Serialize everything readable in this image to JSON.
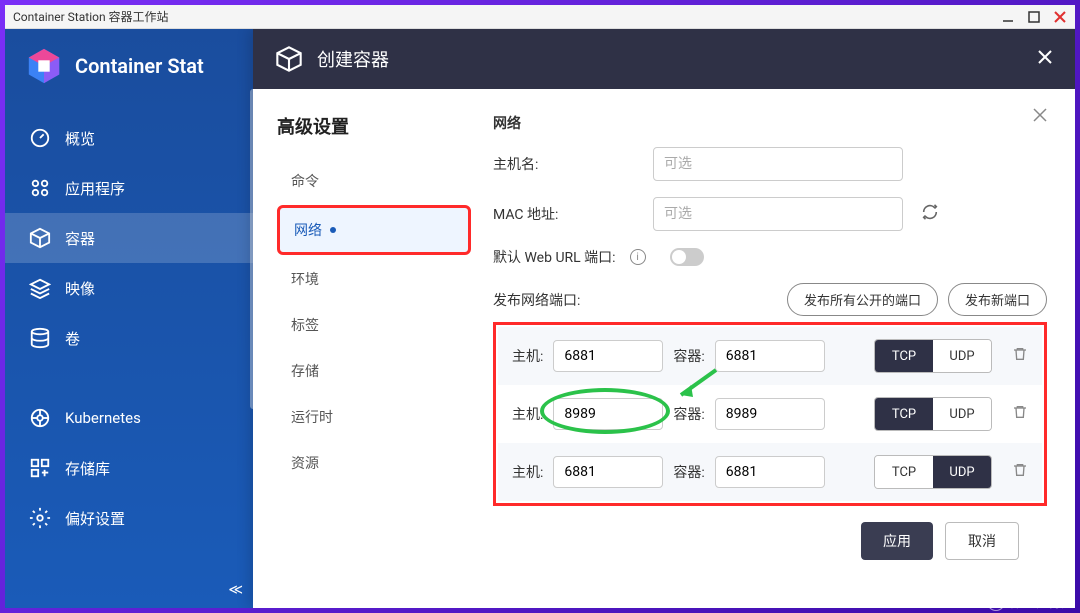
{
  "titlebar": {
    "title": "Container Station 容器工作站"
  },
  "sidebar": {
    "app_name": "Container Stat",
    "items": [
      {
        "label": "概览",
        "icon": "gauge"
      },
      {
        "label": "应用程序",
        "icon": "apps"
      },
      {
        "label": "容器",
        "icon": "cube",
        "active": true
      },
      {
        "label": "映像",
        "icon": "layers"
      },
      {
        "label": "卷",
        "icon": "database"
      }
    ],
    "items2": [
      {
        "label": "Kubernetes",
        "icon": "helm"
      },
      {
        "label": "存储库",
        "icon": "grid-plus"
      },
      {
        "label": "偏好设置",
        "icon": "gear"
      }
    ]
  },
  "modal": {
    "title": "创建容器",
    "settings_title": "高级设置",
    "tabs": [
      {
        "label": "命令"
      },
      {
        "label": "网络",
        "active": true,
        "dot": true
      },
      {
        "label": "环境"
      },
      {
        "label": "标签"
      },
      {
        "label": "存储"
      },
      {
        "label": "运行时"
      },
      {
        "label": "资源"
      }
    ],
    "form": {
      "section_heading": "网络",
      "hostname_label": "主机名:",
      "hostname_placeholder": "可选",
      "mac_label": "MAC 地址:",
      "mac_placeholder": "可选",
      "web_url_label": "默认 Web URL 端口:",
      "publish_label": "发布网络端口:",
      "publish_all_btn": "发布所有公开的端口",
      "publish_new_btn": "发布新端口",
      "host_label": "主机:",
      "container_label": "容器:",
      "tcp": "TCP",
      "udp": "UDP",
      "ports": [
        {
          "host": "6881",
          "container": "6881",
          "proto": "tcp"
        },
        {
          "host": "8989",
          "container": "8989",
          "proto": "tcp"
        },
        {
          "host": "6881",
          "container": "6881",
          "proto": "udp"
        }
      ]
    },
    "apply_btn": "应用",
    "cancel_btn": "取消"
  },
  "watermark": "什么值得买"
}
